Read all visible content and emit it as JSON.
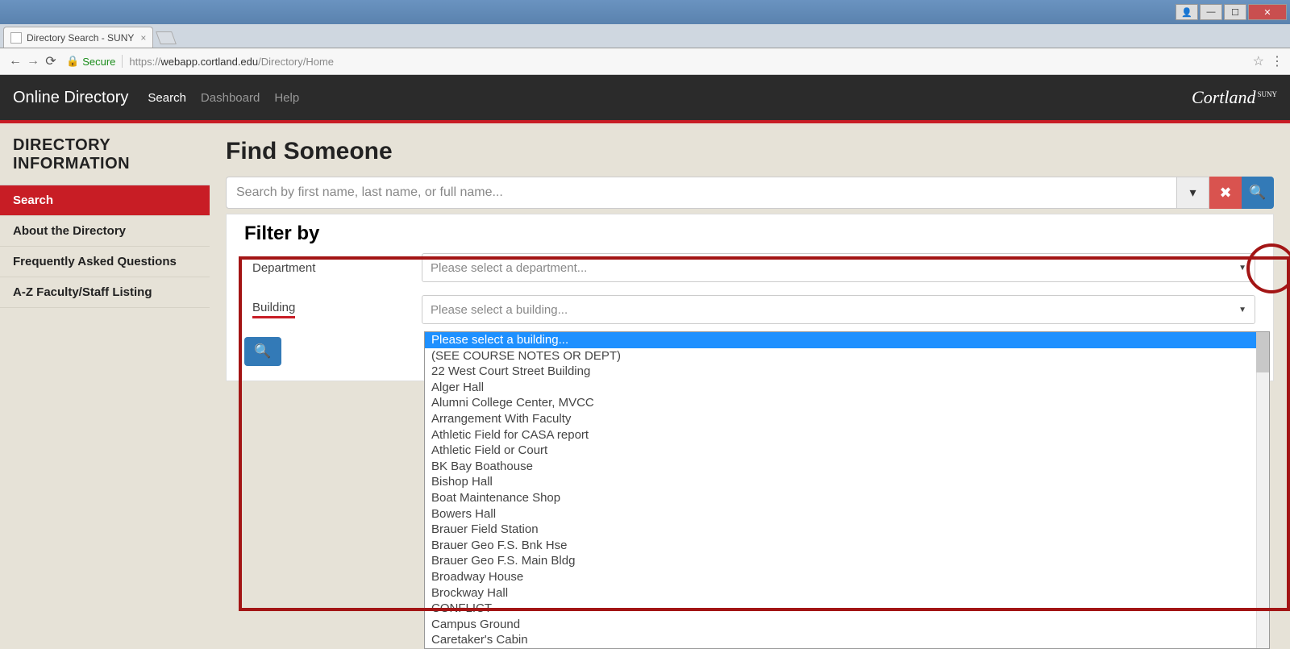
{
  "browser": {
    "tab_title": "Directory Search - SUNY",
    "secure_label": "Secure",
    "url_prefix": "https://",
    "url_host": "webapp.cortland.edu",
    "url_path": "/Directory/Home"
  },
  "header": {
    "brand": "Online Directory",
    "nav": [
      "Search",
      "Dashboard",
      "Help"
    ],
    "logo": "Cortland",
    "logo_sup": "SUNY"
  },
  "sidebar": {
    "title": "DIRECTORY INFORMATION",
    "items": [
      "Search",
      "About the Directory",
      "Frequently Asked Questions",
      "A-Z Faculty/Staff Listing"
    ]
  },
  "page": {
    "title": "Find Someone",
    "search_placeholder": "Search by first name, last name, or full name...",
    "filter_title": "Filter by",
    "dept_label": "Department",
    "dept_placeholder": "Please select a department...",
    "building_label": "Building",
    "building_placeholder": "Please select a building..."
  },
  "building_options": [
    "Please select a building...",
    "(SEE COURSE NOTES OR DEPT)",
    "22 West Court Street Building",
    "Alger Hall",
    "Alumni College Center, MVCC",
    "Arrangement With Faculty",
    "Athletic Field for CASA report",
    "Athletic Field or Court",
    "BK Bay Boathouse",
    "Bishop Hall",
    "Boat Maintenance Shop",
    "Bowers Hall",
    "Brauer Field Station",
    "Brauer Geo F.S. Bnk Hse",
    "Brauer Geo F.S. Main Bldg",
    "Broadway House",
    "Brockway Hall",
    "CONFLICT",
    "Campus Ground",
    "Caretaker's Cabin"
  ]
}
